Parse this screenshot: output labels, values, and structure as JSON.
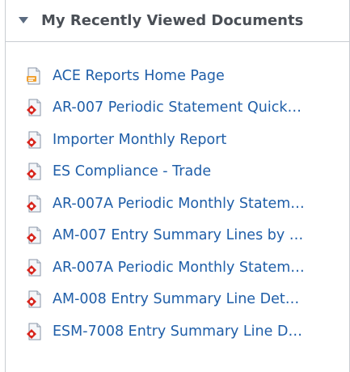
{
  "panel": {
    "title": "My Recently Viewed Documents",
    "toggle_icon": "triangle-down-icon"
  },
  "colors": {
    "link": "#1f5ea8",
    "title": "#4a4f56",
    "border": "#c9cdd2",
    "pointer_arrow": "#c0392b"
  },
  "documents": [
    {
      "label": "ACE Reports Home Page",
      "icon": "html-document-icon"
    },
    {
      "label": "AR-007 Periodic Statement Quick…",
      "icon": "report-document-icon"
    },
    {
      "label": "Importer Monthly Report",
      "icon": "report-document-icon"
    },
    {
      "label": "ES Compliance - Trade",
      "icon": "report-document-icon"
    },
    {
      "label": "AR-007A Periodic Monthly Statem…",
      "icon": "report-document-icon"
    },
    {
      "label": "AM-007 Entry Summary Lines by …",
      "icon": "report-document-icon"
    },
    {
      "label": "AR-007A Periodic Monthly Statem…",
      "icon": "report-document-icon"
    },
    {
      "label": "AM-008 Entry Summary Line Det…",
      "icon": "report-document-icon"
    },
    {
      "label": "ESM-7008 Entry Summary Line D…",
      "icon": "report-document-icon"
    }
  ]
}
